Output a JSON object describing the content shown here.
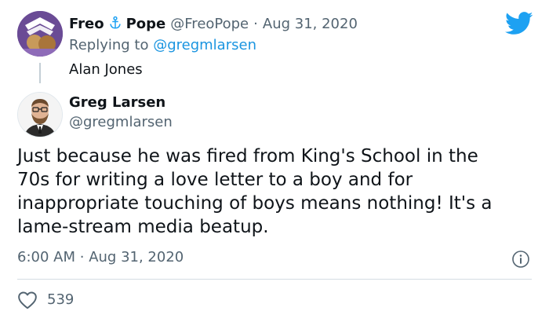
{
  "reply_tweet": {
    "author_name_first": "Freo",
    "author_name_icon": "anchor-icon",
    "author_name_last": "Pope",
    "handle": "@FreoPope",
    "separator": "·",
    "date": "Aug 31, 2020",
    "replying_prefix": "Replying to",
    "replying_to": "@gregmlarsen",
    "text": "Alan Jones"
  },
  "tweet": {
    "author_name": "Greg Larsen",
    "handle": "@gregmlarsen",
    "text_lines": [
      "Just because he was fired from King's School in the",
      "70s for writing a love letter to a boy and for",
      "inappropriate touching of boys means nothing! It's a",
      "lame-stream media beatup."
    ],
    "time": "6:00 AM",
    "separator": "·",
    "date": "Aug 31, 2020",
    "like_count": "539"
  },
  "icons": {
    "brand": "twitter-bird-icon",
    "info": "info-icon",
    "like": "heart-icon"
  },
  "colors": {
    "brand_blue": "#1da1f2",
    "link_blue": "#1b95e0",
    "secondary_text": "#536471",
    "primary_text": "#0f1419"
  }
}
